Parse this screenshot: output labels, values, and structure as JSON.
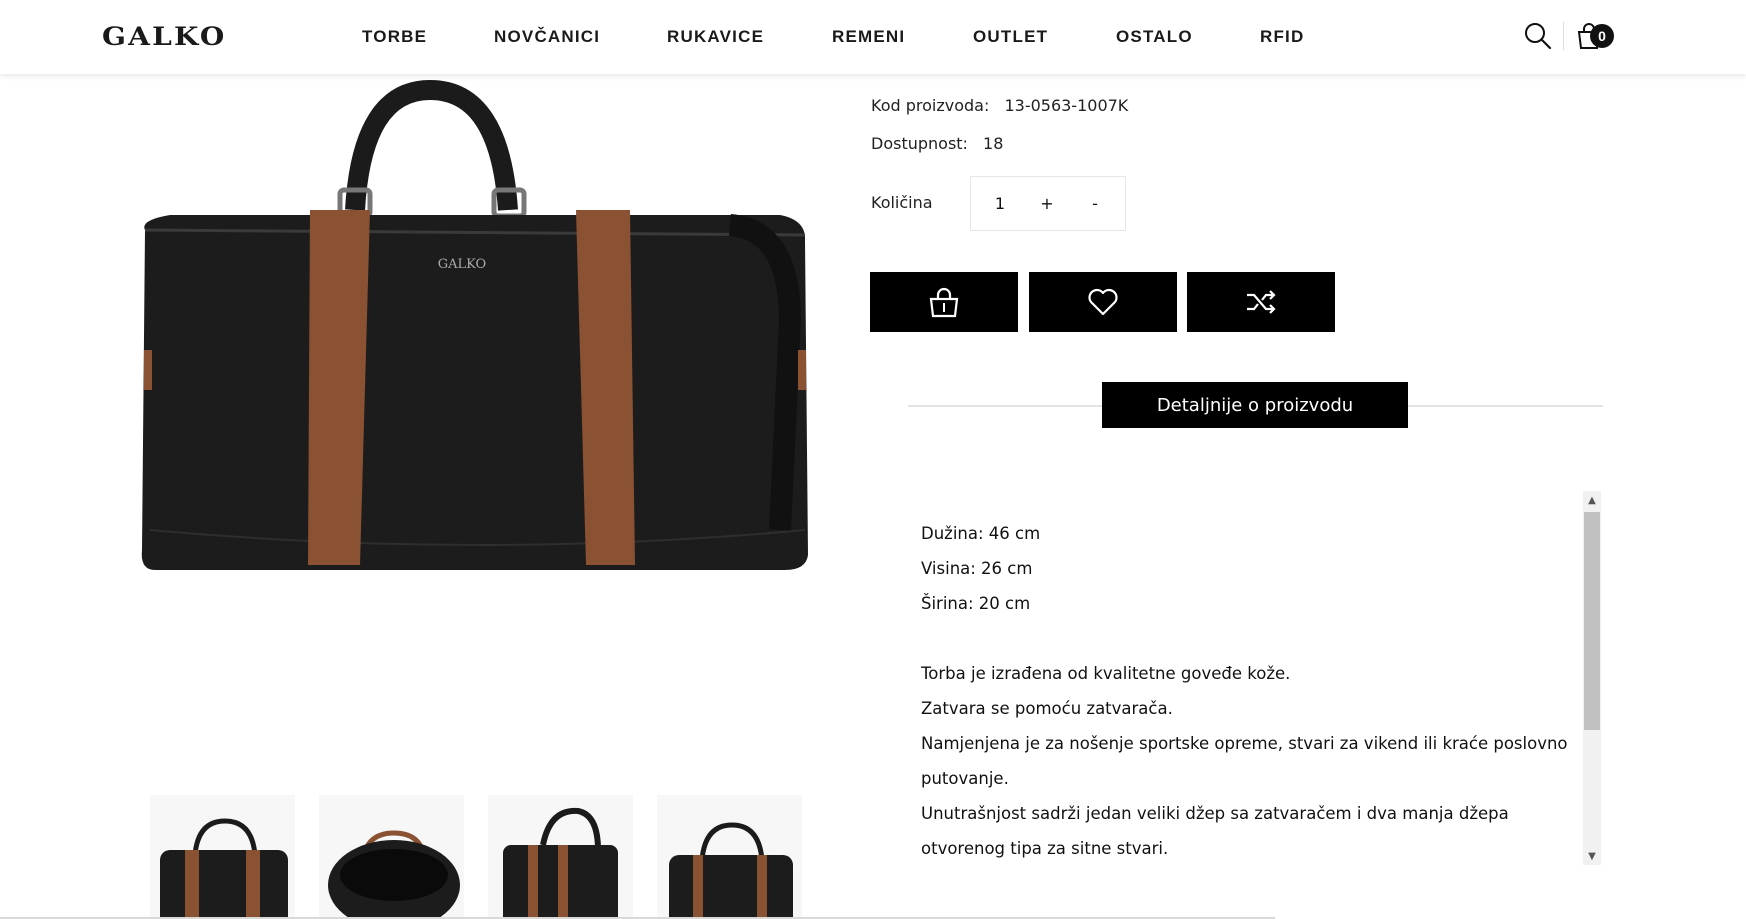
{
  "header": {
    "logo": "GALKO",
    "nav": [
      {
        "label": "TORBE"
      },
      {
        "label": "NOVČANICI"
      },
      {
        "label": "RUKAVICE"
      },
      {
        "label": "REMENI"
      },
      {
        "label": "OUTLET"
      },
      {
        "label": "OSTALO"
      },
      {
        "label": "RFID"
      }
    ],
    "cart_count": "0",
    "icons": [
      "search-icon",
      "shopping-bag-icon"
    ]
  },
  "product": {
    "code_label": "Kod proizvoda:",
    "code_value": "13-0563-1007K",
    "availability_label": "Dostupnost:",
    "availability_value": "18",
    "quantity_label": "Količina",
    "quantity_value": "1",
    "increment_label": "+",
    "decrement_label": "-",
    "actions": [
      "add-to-cart-icon",
      "heart-icon",
      "compare-shuffle-icon"
    ]
  },
  "details": {
    "tab_label": "Detaljnije o proizvodu",
    "dimensions": [
      "Dužina: 46 cm",
      "Visina: 26 cm",
      "Širina: 20 cm"
    ],
    "description": [
      "Torba je izrađena od kvalitetne goveđe kože.",
      "Zatvara se pomoću zatvarača.",
      "Namjenjena je za nošenje sportske opreme, stvari za vikend ili kraće poslovno putovanje.",
      "Unutrašnjost sadrži jedan veliki džep sa zatvaračem i dva manja džepa otvorenog tipa za sitne stvari."
    ]
  },
  "colors": {
    "black": "#000000",
    "leather_brown": "#8a5233",
    "bag_black": "#1b1b1b"
  }
}
